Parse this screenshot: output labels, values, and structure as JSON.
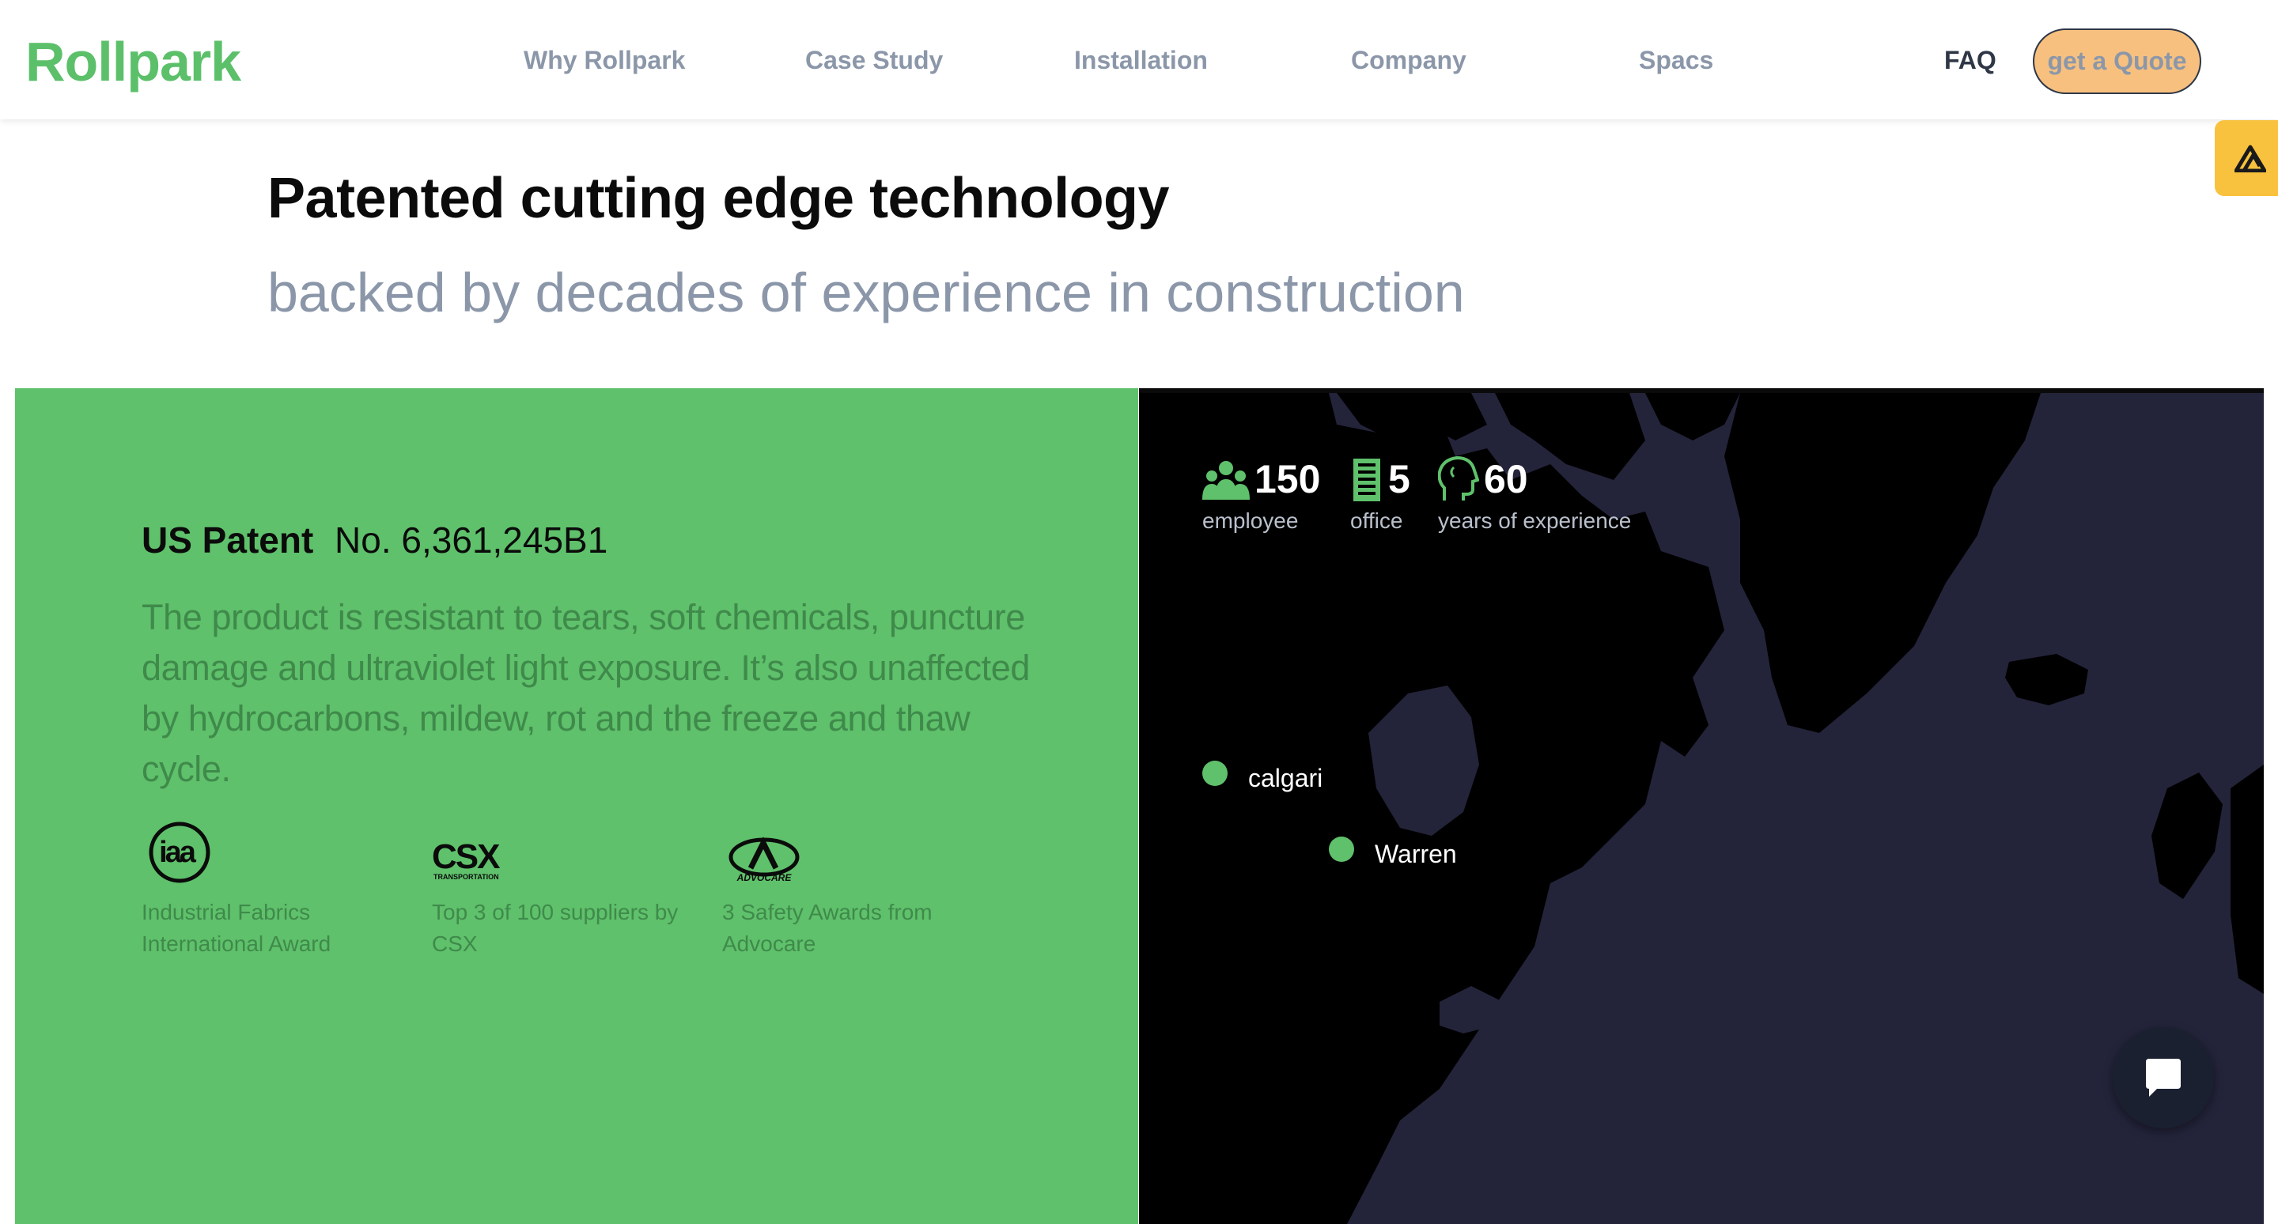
{
  "brand": {
    "logo": "Rollpark",
    "accent": "#5cc06a"
  },
  "nav": {
    "links": [
      "Why Rollpark",
      "Case Study",
      "Installation",
      "Company",
      "Spacs"
    ],
    "faq": "FAQ",
    "quote_label": "get a Quote"
  },
  "hero": {
    "title": "Patented cutting edge technology",
    "subtitle": "backed by decades of experience in construction"
  },
  "patent": {
    "label": "US Patent",
    "number": "No. 6,361,245B1",
    "description": "The product is resistant to tears, soft chemicals, puncture damage and ultraviolet light exposure. It’s also unaffected by hydrocarbons, mildew, rot and the freeze and thaw cycle."
  },
  "awards": [
    {
      "logo_text": "iaa",
      "text": "Industrial Fabrics International Award"
    },
    {
      "logo_text": "CSX",
      "logo_sub": "TRANSPORTATION",
      "text": "Top 3 of 100 suppliers by CSX"
    },
    {
      "logo_text": "ADVOCARE",
      "text": "3 Safety Awards from Advocare"
    }
  ],
  "stats": [
    {
      "icon": "people-icon",
      "value": "150",
      "label": "employee"
    },
    {
      "icon": "building-icon",
      "value": "5",
      "label": "office"
    },
    {
      "icon": "head-icon",
      "value": "60",
      "label": "years of experience"
    }
  ],
  "map": {
    "cities": [
      "calgari",
      "Warren"
    ],
    "land_color": "#000000",
    "water_color": "#23233a",
    "dot_color": "#5fc16b"
  },
  "chat": {
    "icon": "chat-icon"
  }
}
